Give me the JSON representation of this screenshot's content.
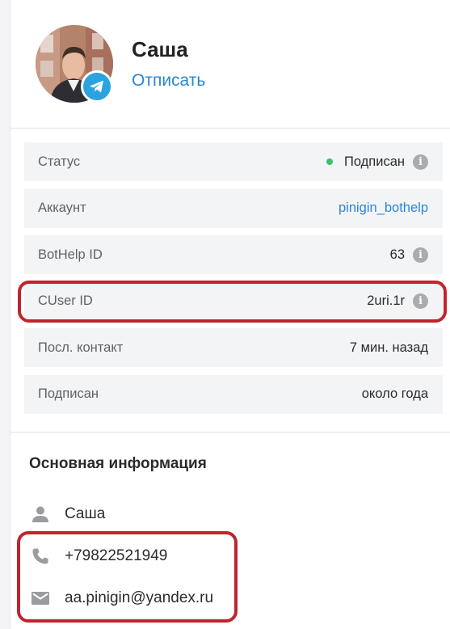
{
  "profile": {
    "name": "Саша",
    "unsubscribe_label": "Отписать"
  },
  "info_rows": [
    {
      "label": "Статус",
      "value": "Подписан"
    },
    {
      "label": "Аккаунт",
      "value": "pinigin_bothelp"
    },
    {
      "label": "BotHelp ID",
      "value": "63"
    },
    {
      "label": "CUser ID",
      "value": "2uri.1r"
    },
    {
      "label": "Посл. контакт",
      "value": "7 мин. назад"
    },
    {
      "label": "Подписан",
      "value": "около года"
    }
  ],
  "section": {
    "title": "Основная информация",
    "name_value": "Саша",
    "phone_value": "+79822521949",
    "email_value": "aa.pinigin@yandex.ru"
  },
  "colors": {
    "link": "#2b86d6",
    "status_green": "#39c368",
    "highlight_red": "#c0242f",
    "telegram_blue": "#2aa3e0"
  },
  "icons": [
    "telegram-icon",
    "info-icon",
    "person-icon",
    "phone-icon",
    "mail-icon"
  ]
}
